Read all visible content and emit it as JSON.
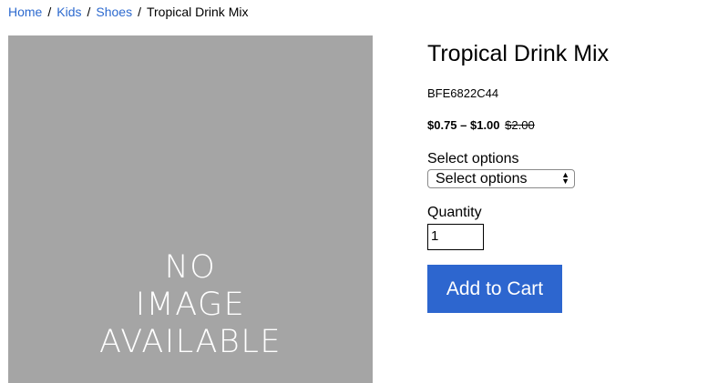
{
  "breadcrumb": {
    "items": [
      "Home",
      "Kids",
      "Shoes"
    ],
    "separator": "/",
    "current": "Tropical Drink Mix"
  },
  "image": {
    "placeholder_lines": [
      "NO",
      "IMAGE",
      "AVAILABLE"
    ]
  },
  "product": {
    "title": "Tropical Drink Mix",
    "sku": "BFE6822C44",
    "price_range": "$0.75 – $1.00",
    "old_price": "$2.00"
  },
  "options": {
    "label": "Select options",
    "selected": "Select options"
  },
  "quantity": {
    "label": "Quantity",
    "value": "1"
  },
  "cart": {
    "button_label": "Add to Cart"
  },
  "colors": {
    "link": "#2d6acf",
    "button": "#2d66cf",
    "placeholder_bg": "#a5a5a5"
  }
}
